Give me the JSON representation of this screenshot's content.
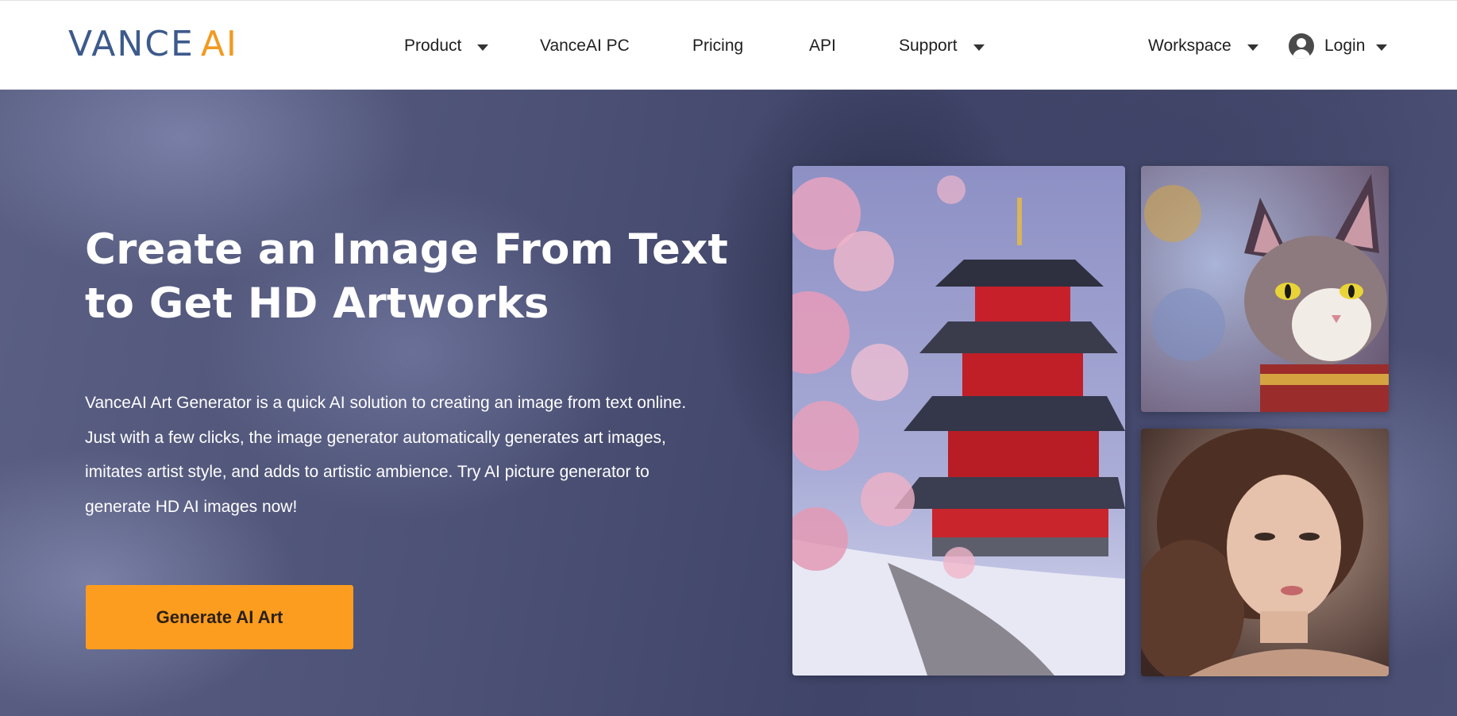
{
  "header": {
    "logo": {
      "brand": "VANCE",
      "suffix": "AI"
    },
    "nav": [
      {
        "label": "Product",
        "has_dropdown": true
      },
      {
        "label": "VanceAI PC",
        "has_dropdown": false
      },
      {
        "label": "Pricing",
        "has_dropdown": false
      },
      {
        "label": "API",
        "has_dropdown": false
      },
      {
        "label": "Support",
        "has_dropdown": true
      }
    ],
    "workspace": {
      "label": "Workspace",
      "has_dropdown": true
    },
    "login": {
      "label": "Login",
      "icon": "user-avatar-icon",
      "has_dropdown": true
    }
  },
  "hero": {
    "title_line1": "Create an Image From Text",
    "title_line2": "to Get HD Artworks",
    "description_lines": [
      "VanceAI Art Generator is a quick AI solution to creating an image from text online.",
      "Just with a few clicks, the image generator automatically generates art images,",
      "imitates artist style, and adds to artistic ambience. Try AI picture generator to",
      "generate HD AI images now!"
    ],
    "cta_label": "Generate AI Art"
  },
  "gallery": [
    {
      "subject": "pagoda with cherry blossoms in snow"
    },
    {
      "subject": "ornate cat portrait"
    },
    {
      "subject": "portrait of a woman"
    }
  ],
  "colors": {
    "brand_blue": "#3d5a8c",
    "brand_orange": "#f29a20",
    "cta_orange": "#fc9d1f",
    "hero_bg": "#4c5175"
  }
}
